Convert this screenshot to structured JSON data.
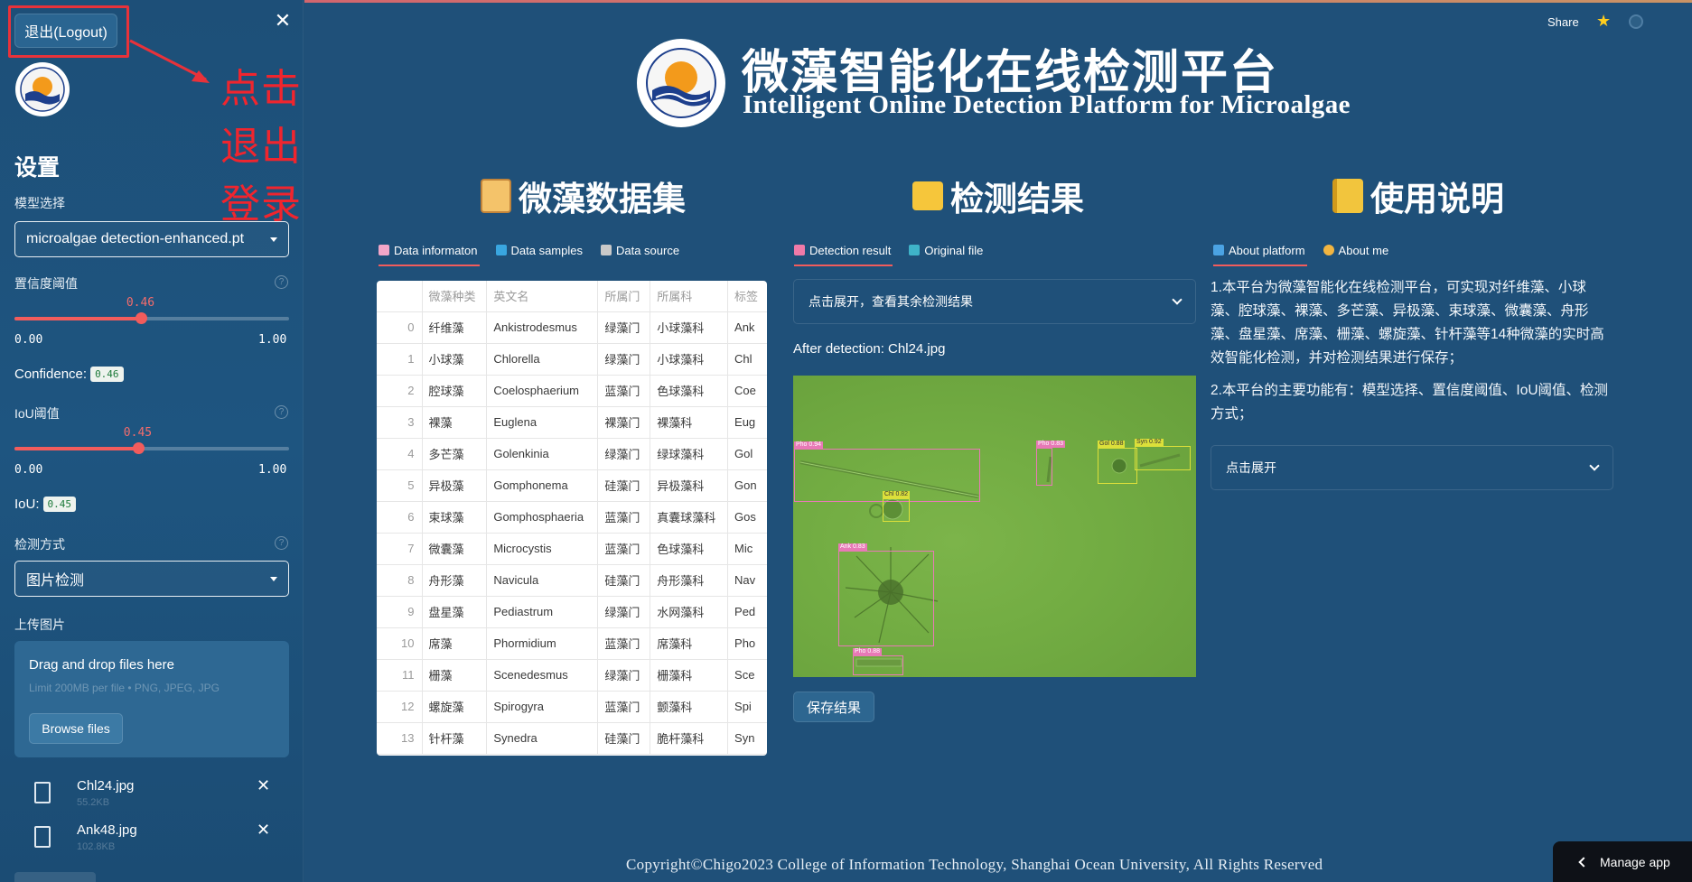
{
  "sidebar": {
    "logout_label": "退出(Logout)",
    "annotation_text": "点击退出登录",
    "settings_heading": "设置",
    "model_label": "模型选择",
    "model_value": "microalgae detection-enhanced.pt",
    "conf_label": "置信度阈值",
    "conf_value": 0.46,
    "conf_value_text": "0.46",
    "conf_min": "0.00",
    "conf_max": "1.00",
    "confidence_caption": "Confidence:",
    "iou_label": "IoU阈值",
    "iou_value": 0.45,
    "iou_value_text": "0.45",
    "iou_min": "0.00",
    "iou_max": "1.00",
    "iou_caption": "IoU:",
    "mode_label": "检测方式",
    "mode_value": "图片检测",
    "upload_label": "上传图片",
    "drag_text": "Drag and drop files here",
    "limit_text": "Limit 200MB per file • PNG, JPEG, JPG",
    "browse_label": "Browse files",
    "files": [
      {
        "name": "Chl24.jpg",
        "size": "55.2KB"
      },
      {
        "name": "Ank48.jpg",
        "size": "102.8KB"
      }
    ]
  },
  "header": {
    "share": "Share",
    "title": "微藻智能化在线检测平台",
    "subtitle": "Intelligent Online Detection Platform for Microalgae"
  },
  "columns": {
    "dataset": {
      "title": "微藻数据集",
      "tabs": [
        "Data informaton",
        "Data samples",
        "Data source"
      ]
    },
    "results": {
      "title": "检测结果",
      "tabs": [
        "Detection result",
        "Original file"
      ],
      "expander": "点击展开，查看其余检测结果",
      "after_label": "After detection: Chl24.jpg",
      "save_label": "保存结果",
      "detections": [
        {
          "label": "Pho 0.94"
        },
        {
          "label": "Pho 0.83"
        },
        {
          "label": "Gol 0.88"
        },
        {
          "label": "Syn 0.92"
        },
        {
          "label": "Chl 0.82"
        },
        {
          "label": "Ank 0.83"
        },
        {
          "label": "Pho 0.88"
        }
      ]
    },
    "about": {
      "title": "使用说明",
      "tabs": [
        "About platform",
        "About me"
      ],
      "para1": "1.本平台为微藻智能化在线检测平台，可实现对纤维藻、小球藻、腔球藻、裸藻、多芒藻、异极藻、束球藻、微囊藻、舟形藻、盘星藻、席藻、栅藻、螺旋藻、针杆藻等14种微藻的实时高效智能化检测，并对检测结果进行保存；",
      "para2": "2.本平台的主要功能有：模型选择、置信度阈值、IoU阈值、检测方式；",
      "expander": "点击展开"
    }
  },
  "table": {
    "headers": [
      "",
      "微藻种类",
      "英文名",
      "所属门",
      "所属科",
      "标签"
    ],
    "rows": [
      [
        "0",
        "纤维藻",
        "Ankistrodesmus",
        "绿藻门",
        "小球藻科",
        "Ank"
      ],
      [
        "1",
        "小球藻",
        "Chlorella",
        "绿藻门",
        "小球藻科",
        "Chl"
      ],
      [
        "2",
        "腔球藻",
        "Coelosphaerium",
        "蓝藻门",
        "色球藻科",
        "Coe"
      ],
      [
        "3",
        "裸藻",
        "Euglena",
        "裸藻门",
        "裸藻科",
        "Eug"
      ],
      [
        "4",
        "多芒藻",
        "Golenkinia",
        "绿藻门",
        "绿球藻科",
        "Gol"
      ],
      [
        "5",
        "异极藻",
        "Gomphonema",
        "硅藻门",
        "异极藻科",
        "Gon"
      ],
      [
        "6",
        "束球藻",
        "Gomphosphaeria",
        "蓝藻门",
        "真囊球藻科",
        "Gos"
      ],
      [
        "7",
        "微囊藻",
        "Microcystis",
        "蓝藻门",
        "色球藻科",
        "Mic"
      ],
      [
        "8",
        "舟形藻",
        "Navicula",
        "硅藻门",
        "舟形藻科",
        "Nav"
      ],
      [
        "9",
        "盘星藻",
        "Pediastrum",
        "绿藻门",
        "水网藻科",
        "Ped"
      ],
      [
        "10",
        "席藻",
        "Phormidium",
        "蓝藻门",
        "席藻科",
        "Pho"
      ],
      [
        "11",
        "栅藻",
        "Scenedesmus",
        "绿藻门",
        "栅藻科",
        "Sce"
      ],
      [
        "12",
        "螺旋藻",
        "Spirogyra",
        "蓝藻门",
        "颤藻科",
        "Spi"
      ],
      [
        "13",
        "针杆藻",
        "Synedra",
        "硅藻门",
        "脆杆藻科",
        "Syn"
      ]
    ]
  },
  "footer": "Copyright©Chigo2023  College of Information Technology, Shanghai Ocean University, All Rights Reserved",
  "manage_label": "Manage app",
  "colors": {
    "background": "#1f5079",
    "accent": "#f25c5c",
    "annotation": "#e8323a"
  }
}
